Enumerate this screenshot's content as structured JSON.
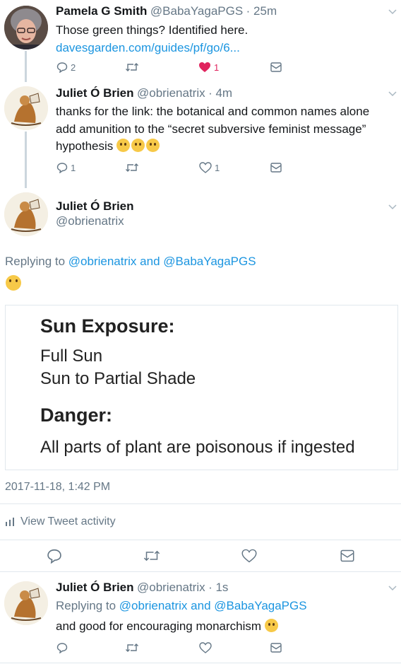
{
  "colors": {
    "link": "#1b95e0",
    "muted": "#657786",
    "like": "#e0245e",
    "divider": "#e1e8ed"
  },
  "tweet1": {
    "name": "Pamela G Smith",
    "handle": "@BabaYagaPGS",
    "time": "· 25m",
    "text": "Those green things? Identified here.",
    "link": "davesgarden.com/guides/pf/go/6...",
    "reply_count": "2",
    "retweet_count": "",
    "like_count": "1"
  },
  "tweet2": {
    "name": "Juliet Ó Brien",
    "handle": "@obrienatrix",
    "time": "· 4m",
    "text_line1": "thanks for the link: the botanical and common names alone",
    "text_line2": "add amunition to the “secret subversive feminist message”",
    "text_line3": "hypothesis",
    "reply_count": "1",
    "like_count": "1"
  },
  "main": {
    "name": "Juliet Ó Brien",
    "handle": "@obrienatrix",
    "replying_prefix": "Replying to",
    "replying_to_1": "@obrienatrix",
    "replying_and": "and",
    "replying_to_2": "@BabaYagaPGS",
    "card": {
      "heading1": "Sun Exposure:",
      "line1": "Full Sun",
      "line2": "Sun to Partial Shade",
      "heading2": "Danger:",
      "line3": "All parts of plant are poisonous if ingested"
    },
    "timestamp": "2017-11-18, 1:42 PM",
    "activity_label": "View Tweet activity"
  },
  "tweet4": {
    "name": "Juliet Ó Brien",
    "handle": "@obrienatrix",
    "time": "· 1s",
    "replying_prefix": "Replying to",
    "replying_to_1": "@obrienatrix",
    "replying_and": "and",
    "replying_to_2": "@BabaYagaPGS",
    "text": "and good for encouraging monarchism"
  }
}
